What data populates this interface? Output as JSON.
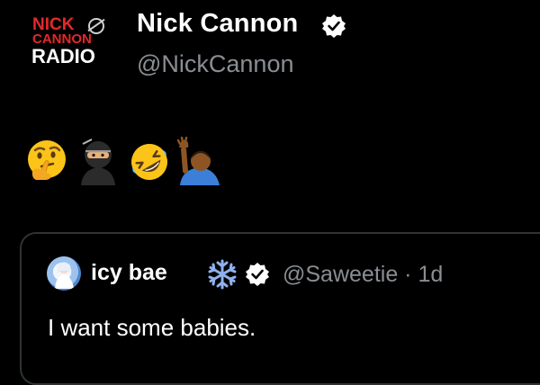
{
  "author": {
    "logo_line1": "NICK",
    "logo_line2": "CANNON",
    "logo_line3": "RADIO",
    "display_name": "Nick Cannon",
    "handle": "@NickCannon",
    "verified": true
  },
  "tweet": {
    "emojis": [
      "thinking-face",
      "ninja",
      "rolling-on-floor-laughing",
      "person-raising-hand-dark-skin"
    ]
  },
  "quoted_tweet": {
    "display_name": "icy bae",
    "name_emoji": "snowflake",
    "verified": true,
    "meta": "@Saweetie · 1d",
    "text": "I want some babies."
  },
  "colors": {
    "background": "#000000",
    "text_primary": "#ffffff",
    "text_secondary": "#8a8e93",
    "logo_red": "#e4282b",
    "border": "#2f3336",
    "snowflake": "#8fb2ee"
  }
}
